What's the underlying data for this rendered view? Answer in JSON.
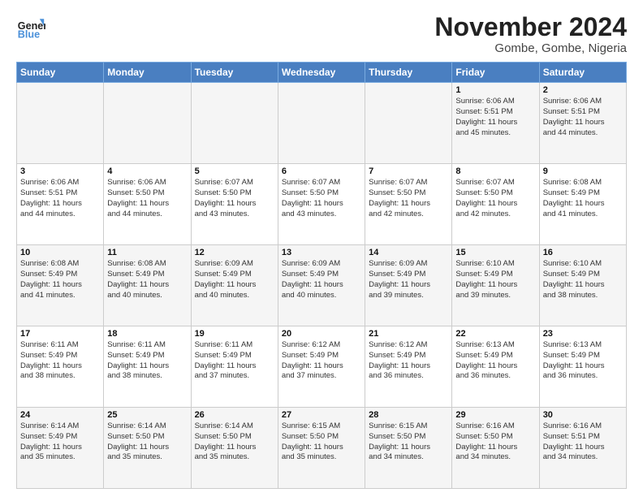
{
  "logo": {
    "line1": "General",
    "line2": "Blue"
  },
  "title": "November 2024",
  "subtitle": "Gombe, Gombe, Nigeria",
  "weekdays": [
    "Sunday",
    "Monday",
    "Tuesday",
    "Wednesday",
    "Thursday",
    "Friday",
    "Saturday"
  ],
  "weeks": [
    [
      {
        "day": "",
        "info": ""
      },
      {
        "day": "",
        "info": ""
      },
      {
        "day": "",
        "info": ""
      },
      {
        "day": "",
        "info": ""
      },
      {
        "day": "",
        "info": ""
      },
      {
        "day": "1",
        "info": "Sunrise: 6:06 AM\nSunset: 5:51 PM\nDaylight: 11 hours\nand 45 minutes."
      },
      {
        "day": "2",
        "info": "Sunrise: 6:06 AM\nSunset: 5:51 PM\nDaylight: 11 hours\nand 44 minutes."
      }
    ],
    [
      {
        "day": "3",
        "info": "Sunrise: 6:06 AM\nSunset: 5:51 PM\nDaylight: 11 hours\nand 44 minutes."
      },
      {
        "day": "4",
        "info": "Sunrise: 6:06 AM\nSunset: 5:50 PM\nDaylight: 11 hours\nand 44 minutes."
      },
      {
        "day": "5",
        "info": "Sunrise: 6:07 AM\nSunset: 5:50 PM\nDaylight: 11 hours\nand 43 minutes."
      },
      {
        "day": "6",
        "info": "Sunrise: 6:07 AM\nSunset: 5:50 PM\nDaylight: 11 hours\nand 43 minutes."
      },
      {
        "day": "7",
        "info": "Sunrise: 6:07 AM\nSunset: 5:50 PM\nDaylight: 11 hours\nand 42 minutes."
      },
      {
        "day": "8",
        "info": "Sunrise: 6:07 AM\nSunset: 5:50 PM\nDaylight: 11 hours\nand 42 minutes."
      },
      {
        "day": "9",
        "info": "Sunrise: 6:08 AM\nSunset: 5:49 PM\nDaylight: 11 hours\nand 41 minutes."
      }
    ],
    [
      {
        "day": "10",
        "info": "Sunrise: 6:08 AM\nSunset: 5:49 PM\nDaylight: 11 hours\nand 41 minutes."
      },
      {
        "day": "11",
        "info": "Sunrise: 6:08 AM\nSunset: 5:49 PM\nDaylight: 11 hours\nand 40 minutes."
      },
      {
        "day": "12",
        "info": "Sunrise: 6:09 AM\nSunset: 5:49 PM\nDaylight: 11 hours\nand 40 minutes."
      },
      {
        "day": "13",
        "info": "Sunrise: 6:09 AM\nSunset: 5:49 PM\nDaylight: 11 hours\nand 40 minutes."
      },
      {
        "day": "14",
        "info": "Sunrise: 6:09 AM\nSunset: 5:49 PM\nDaylight: 11 hours\nand 39 minutes."
      },
      {
        "day": "15",
        "info": "Sunrise: 6:10 AM\nSunset: 5:49 PM\nDaylight: 11 hours\nand 39 minutes."
      },
      {
        "day": "16",
        "info": "Sunrise: 6:10 AM\nSunset: 5:49 PM\nDaylight: 11 hours\nand 38 minutes."
      }
    ],
    [
      {
        "day": "17",
        "info": "Sunrise: 6:11 AM\nSunset: 5:49 PM\nDaylight: 11 hours\nand 38 minutes."
      },
      {
        "day": "18",
        "info": "Sunrise: 6:11 AM\nSunset: 5:49 PM\nDaylight: 11 hours\nand 38 minutes."
      },
      {
        "day": "19",
        "info": "Sunrise: 6:11 AM\nSunset: 5:49 PM\nDaylight: 11 hours\nand 37 minutes."
      },
      {
        "day": "20",
        "info": "Sunrise: 6:12 AM\nSunset: 5:49 PM\nDaylight: 11 hours\nand 37 minutes."
      },
      {
        "day": "21",
        "info": "Sunrise: 6:12 AM\nSunset: 5:49 PM\nDaylight: 11 hours\nand 36 minutes."
      },
      {
        "day": "22",
        "info": "Sunrise: 6:13 AM\nSunset: 5:49 PM\nDaylight: 11 hours\nand 36 minutes."
      },
      {
        "day": "23",
        "info": "Sunrise: 6:13 AM\nSunset: 5:49 PM\nDaylight: 11 hours\nand 36 minutes."
      }
    ],
    [
      {
        "day": "24",
        "info": "Sunrise: 6:14 AM\nSunset: 5:49 PM\nDaylight: 11 hours\nand 35 minutes."
      },
      {
        "day": "25",
        "info": "Sunrise: 6:14 AM\nSunset: 5:50 PM\nDaylight: 11 hours\nand 35 minutes."
      },
      {
        "day": "26",
        "info": "Sunrise: 6:14 AM\nSunset: 5:50 PM\nDaylight: 11 hours\nand 35 minutes."
      },
      {
        "day": "27",
        "info": "Sunrise: 6:15 AM\nSunset: 5:50 PM\nDaylight: 11 hours\nand 35 minutes."
      },
      {
        "day": "28",
        "info": "Sunrise: 6:15 AM\nSunset: 5:50 PM\nDaylight: 11 hours\nand 34 minutes."
      },
      {
        "day": "29",
        "info": "Sunrise: 6:16 AM\nSunset: 5:50 PM\nDaylight: 11 hours\nand 34 minutes."
      },
      {
        "day": "30",
        "info": "Sunrise: 6:16 AM\nSunset: 5:51 PM\nDaylight: 11 hours\nand 34 minutes."
      }
    ]
  ]
}
